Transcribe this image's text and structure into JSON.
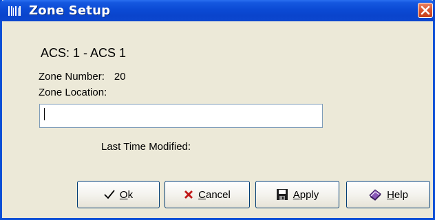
{
  "window": {
    "title": "Zone Setup"
  },
  "content": {
    "acs_label": "ACS: 1 - ACS 1",
    "zone_number_label": "Zone Number:",
    "zone_number_value": "20",
    "zone_location_label": "Zone Location:",
    "zone_location_value": "",
    "last_modified_label": "Last Time Modified:"
  },
  "buttons": {
    "ok": {
      "accel": "O",
      "rest": "k",
      "icon": "checkmark-icon"
    },
    "cancel": {
      "accel": "C",
      "rest": "ancel",
      "icon": "x-icon"
    },
    "apply": {
      "accel": "A",
      "rest": "pply",
      "icon": "floppy-disk-icon"
    },
    "help": {
      "accel": "H",
      "rest": "elp",
      "icon": "help-book-icon"
    }
  },
  "colors": {
    "titlebar": "#0a44cc",
    "close_button": "#d9532e",
    "dialog_background": "#ece9d8"
  }
}
